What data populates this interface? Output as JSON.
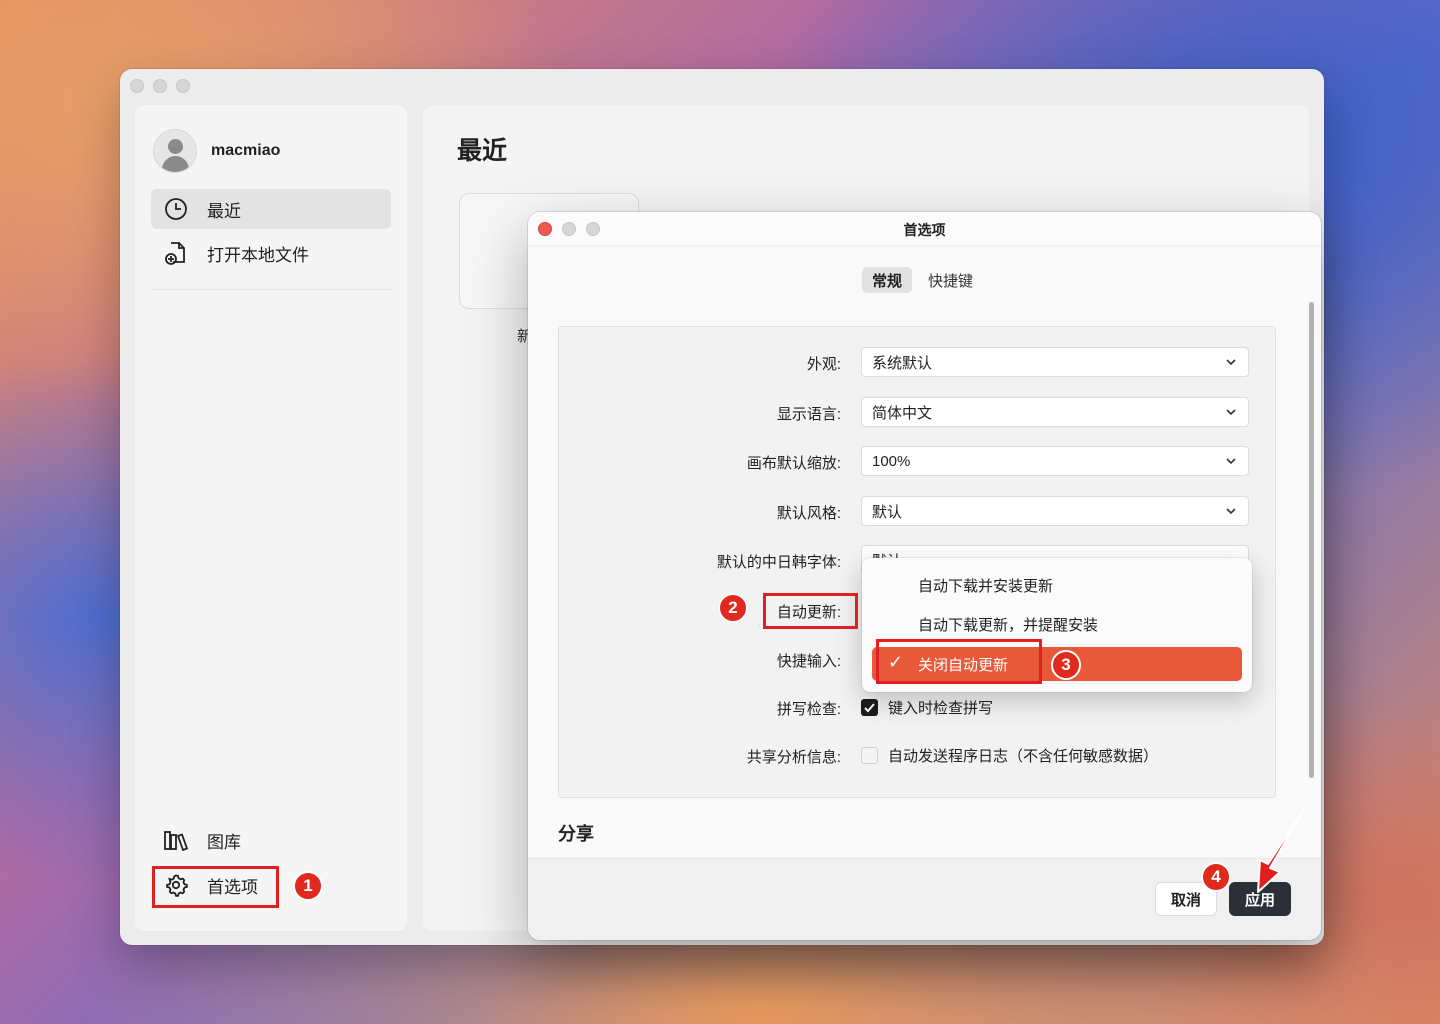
{
  "app": {
    "username": "macmiao",
    "sidebar": {
      "items": [
        {
          "label": "最近",
          "icon": "clock-icon"
        },
        {
          "label": "打开本地文件",
          "icon": "file-plus-icon"
        }
      ],
      "bottom_items": [
        {
          "label": "图库",
          "icon": "library-icon"
        },
        {
          "label": "首选项",
          "icon": "gear-icon"
        }
      ]
    },
    "content": {
      "title": "最近",
      "thumb_label": "新"
    }
  },
  "dialog": {
    "title": "首选项",
    "tabs": [
      "常规",
      "快捷键"
    ],
    "rows": [
      {
        "label": "外观:",
        "value": "系统默认"
      },
      {
        "label": "显示语言:",
        "value": "简体中文"
      },
      {
        "label": "画布默认缩放:",
        "value": "100%"
      },
      {
        "label": "默认风格:",
        "value": "默认"
      },
      {
        "label": "默认的中日韩字体:",
        "value": "默认"
      },
      {
        "label": "自动更新:",
        "value": ""
      },
      {
        "label": "快捷输入:",
        "value": ""
      },
      {
        "label": "拼写检查:",
        "value": "键入时检查拼写",
        "checked": true
      },
      {
        "label": "共享分析信息:",
        "value": "自动发送程序日志（不含任何敏感数据）",
        "checked": false
      }
    ],
    "section": "分享",
    "buttons": {
      "cancel": "取消",
      "apply": "应用"
    },
    "dropdown_menu": {
      "options": [
        "自动下载并安装更新",
        "自动下载更新，并提醒安装",
        "关闭自动更新"
      ],
      "selected_index": 2,
      "check_mark": "✓"
    }
  },
  "annotations": {
    "badges": [
      "1",
      "2",
      "3",
      "4"
    ],
    "color": "#e02020"
  }
}
